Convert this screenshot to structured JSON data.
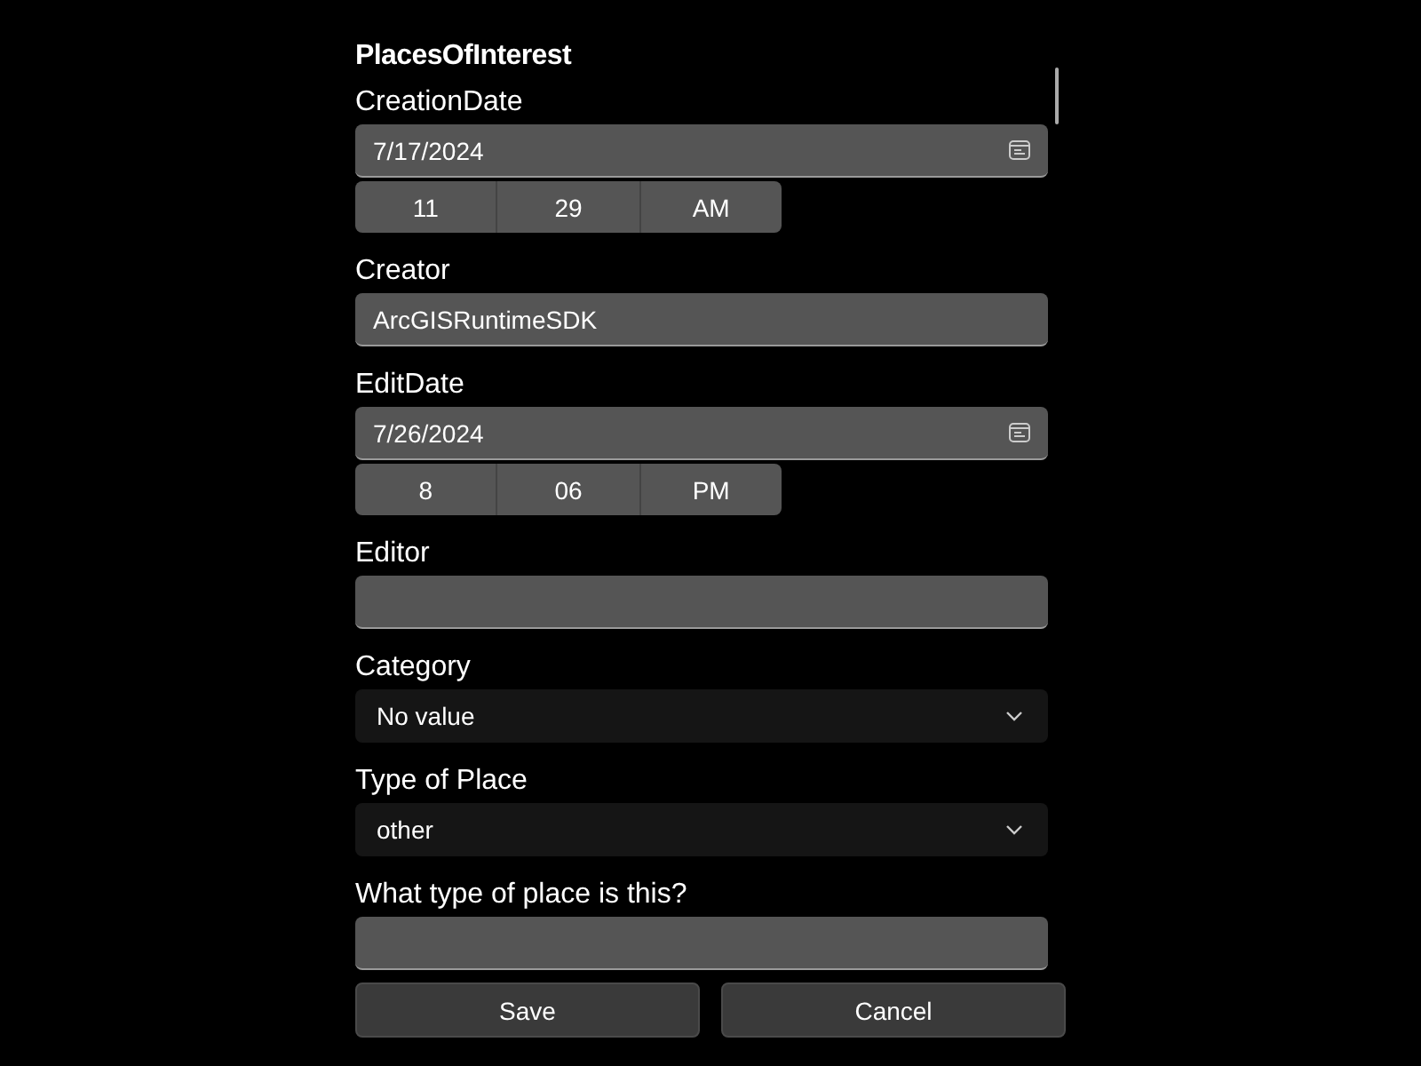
{
  "form": {
    "title": "PlacesOfInterest",
    "fields": [
      {
        "kind": "date",
        "label": "CreationDate",
        "value": "7/17/2024",
        "time": [
          "11",
          "29",
          "AM"
        ]
      },
      {
        "kind": "text",
        "label": "Creator",
        "value": "ArcGISRuntimeSDK"
      },
      {
        "kind": "date",
        "label": "EditDate",
        "value": "7/26/2024",
        "time": [
          "8",
          "06",
          "PM"
        ]
      },
      {
        "kind": "text",
        "label": "Editor"
      },
      {
        "kind": "combo",
        "label": "Category",
        "value": "No value"
      },
      {
        "kind": "combo",
        "label": "Type of Place",
        "value": "other"
      },
      {
        "kind": "text",
        "label": "What type of place is this?"
      }
    ]
  },
  "buttons": [
    "Save",
    "Cancel"
  ]
}
